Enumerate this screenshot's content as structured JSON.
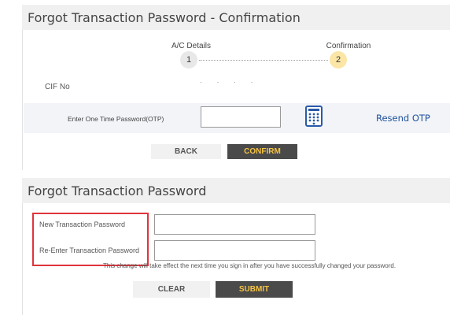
{
  "confirmation_section": {
    "title": "Forgot Transaction Password - Confirmation",
    "steps": [
      {
        "label": "A/C Details",
        "number": "1"
      },
      {
        "label": "Confirmation",
        "number": "2"
      }
    ],
    "cif_label": "CIF No",
    "cif_value": "· · · ·",
    "otp_label": "Enter One Time Password(OTP)",
    "otp_value": "",
    "resend_otp": "Resend OTP",
    "back_button": "BACK",
    "confirm_button": "CONFIRM"
  },
  "password_section": {
    "title": "Forgot Transaction Password",
    "new_password_label": "New Transaction Password",
    "reenter_password_label": "Re-Enter Transaction Password",
    "new_password_value": "",
    "reenter_password_value": "",
    "note": "This change will take effect the next time you sign in after you have successfully changed your password.",
    "clear_button": "CLEAR",
    "submit_button": "SUBMIT"
  },
  "colors": {
    "header_bg": "#f0f0f0",
    "accent_text": "#f6c342",
    "dark_button": "#4a4a4a",
    "link": "#1c4f9c",
    "highlight": "#e0343b",
    "active_step": "#fbe6a6"
  },
  "icons": {
    "keypad": "virtual-keypad-icon"
  }
}
